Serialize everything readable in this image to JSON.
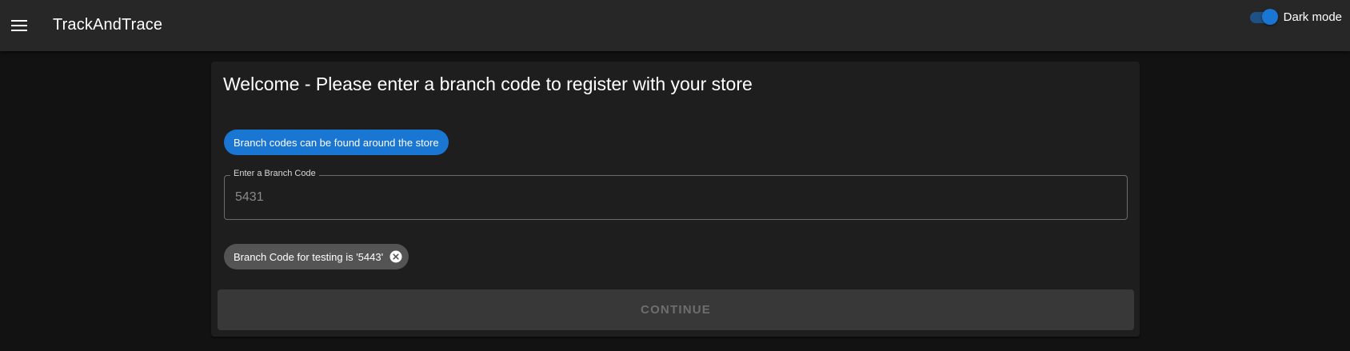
{
  "appbar": {
    "title": "TrackAndTrace",
    "menu_icon": "menu-icon",
    "dark_mode": {
      "label": "Dark mode",
      "enabled": true
    }
  },
  "card": {
    "heading": "Welcome - Please enter a branch code to register with your store",
    "info_chip": "Branch codes can be found around the store",
    "branch_field": {
      "label": "Enter a Branch Code",
      "placeholder": "5431",
      "value": ""
    },
    "test_chip": {
      "label": "Branch Code for testing is '5443'",
      "delete_icon": "cancel-circle-icon"
    },
    "continue_label": "Continue"
  },
  "colors": {
    "primary": "#1976d2",
    "appbar": "#272727",
    "background": "#121212",
    "card": "#1e1e1e"
  }
}
